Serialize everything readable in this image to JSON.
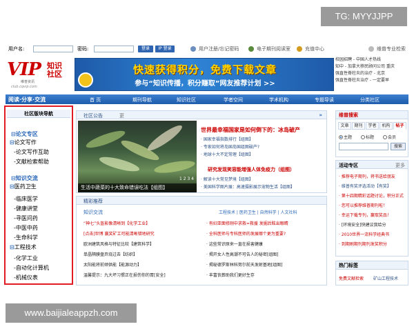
{
  "watermark_top": "TG: MYYJJPP",
  "watermark_bottom": "www.baijialeappzh.com",
  "login": {
    "user_label": "用户名:",
    "pass_label": "密码:",
    "login_btn": "登录",
    "ip_btn": "IP 登录",
    "links": [
      "用户注册/忘记密码",
      "电子期刊阅读室",
      "充值中心"
    ],
    "right": "维普专业检索"
  },
  "logo": {
    "vip": "VIP",
    "zhishi": "知识社区",
    "sub": "维普资讯",
    "url": "club.cqvip.com"
  },
  "banner": {
    "line1": "快速获得积分，免费下载文章",
    "line2": "参与“知识传播，积分赚取”网友推荐计划 >>"
  },
  "right_links": [
    "校园招聘 - 中国人才热线",
    "知中 - 加拿大移民顾问公司 重庆",
    "强直性脊柱炎的治疗 - 北京",
    "强直性脊柱炎治疗 - 一定要早"
  ],
  "nav": {
    "slogan": "阅读·分享·交流",
    "items": [
      "首 页",
      "期刊导航",
      "知识社区",
      "学者空间",
      "学术机构",
      "专题导读",
      "分类社区"
    ]
  },
  "sidebar": {
    "title": "社区版块导航",
    "sections": [
      {
        "name": "论文专区",
        "groups": [
          {
            "cat": "论文写作",
            "items": [
              "论文写作互助",
              "文献检索帮助"
            ]
          }
        ]
      },
      {
        "name": "知识交流",
        "groups": [
          {
            "cat": "医药卫生",
            "items": [
              "临床医学",
              "健康讲堂",
              "寻医问药",
              "中医中药",
              "生命科学"
            ]
          },
          {
            "cat": "工程技术",
            "items": [
              "化学工业",
              "自动化计算机",
              "机械仪表"
            ]
          }
        ]
      }
    ]
  },
  "notice": {
    "title": "社区公告",
    "more": "更",
    "arrow": "»",
    "photo_caption": "生活中蔬菜的十大致命错误吃法【组图】",
    "photo_dots": "1 2 3 4",
    "headline": "世界最幸福国家是如何倒下的：冰岛破产",
    "lines": [
      "· 国家幸福指数排行【组图】",
      "· 专家如何将岛国岛国组图破产?",
      "· 地球十大不定常理【组图】"
    ],
    "headline2": "研究发现笑容能增强人体免疫力（组图）",
    "lines2": [
      "· 解读十大常见梦境【组图】",
      "· 美国科学图片展：高速摄影展示宠物生活【组图】"
    ]
  },
  "featured": {
    "title": "精彩推荐",
    "subtitle": "知识交流",
    "tags": "工程技术 | 医药卫生 | 自然科学 | 人文社科",
    "left_rows": [
      "“神七”头盔影像清晰到【化学工业】",
      "[点击]世博 赢奖矿工可能清晰错地研究",
      "欧洲建筑风格与特征比较【建筑科学】",
      "单晶隔膜盘弃烧过去【纺织】",
      "太阳能将前倾供能【能源动力】",
      "温馨提示：九大坏习惯正在损伤你的胃[安全]"
    ],
    "right_rows": [
      "· 有妇亚面修刚中求救=救援 发掘后眩出眼睛",
      "· 全科医师与专科医师的发展哪个更为重要?",
      "· 这些常识原来一直在损害健康",
      "· 揭开女人性高潮不可告人的秘密[组图]",
      "· 揭秘德罗斯林科努尔前天发射基地[组图]",
      "· 丰富丧葬助我们更好生存"
    ]
  },
  "search": {
    "title": "维普搜索",
    "tabs": [
      "文章",
      "期刊",
      "学者",
      "机构",
      "帖子"
    ],
    "radios": [
      "主题",
      "标题",
      "会员"
    ],
    "go": "搜索"
  },
  "events": {
    "title": "活动专区",
    "more": "更多",
    "items": [
      "· 推荐电子期刊，将书送给朋友",
      "· 维普有奖评选活动【有奖】",
      "· 第十四期精彩话题讨论，积分正式",
      "· 您可以推荐维普期刊啦！",
      "· 幸运下载专刊，赢取奖品！",
      "· [环境安全]快建议我给分",
      "· 2010世界一流科学经典书",
      "· 到期刷期刊期刊发奖积分"
    ]
  },
  "hottags": {
    "title": "热门标签",
    "tags": [
      "免费文献检索",
      "矿山工程技术"
    ]
  }
}
